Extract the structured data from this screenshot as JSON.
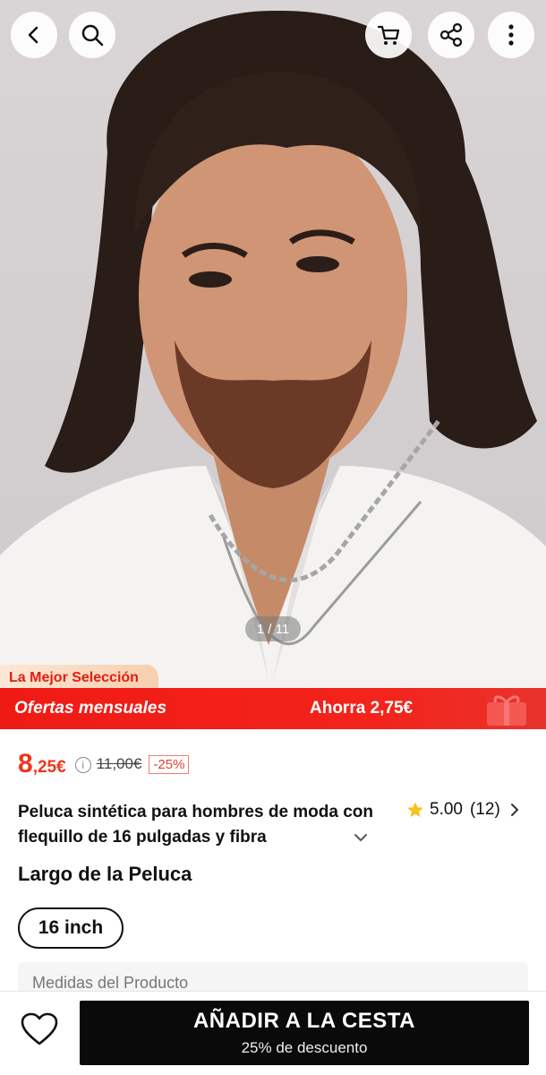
{
  "gallery": {
    "counter": "1 / 11",
    "badge": "La Mejor Selección"
  },
  "top_actions": {
    "back_icon": "chevron-left-icon",
    "search_icon": "search-icon",
    "cart_icon": "cart-icon",
    "share_icon": "share-icon",
    "more_icon": "more-vertical-icon"
  },
  "promo": {
    "left": "Ofertas mensuales",
    "right": "Ahorra 2,75€"
  },
  "price": {
    "integer": "8",
    "decimal": ",25€",
    "info_icon": "i",
    "original": "11,00€",
    "discount": "-25%"
  },
  "product": {
    "title": "Peluca sintética para hombres de moda con flequillo de 16 pulgadas y fibra",
    "rating": "5.00",
    "reviews": "(12)"
  },
  "variant": {
    "section_title": "Largo de la Peluca",
    "selected": "16 inch"
  },
  "specs": {
    "label": "Medidas del Producto"
  },
  "bottom": {
    "add_to_cart": "AÑADIR A LA CESTA",
    "subtitle": "25% de descuento"
  },
  "colors": {
    "accent_red": "#f01a14",
    "price_red": "#f0351c",
    "star": "#f7c21a",
    "cart_button": "#0a0a0a"
  }
}
